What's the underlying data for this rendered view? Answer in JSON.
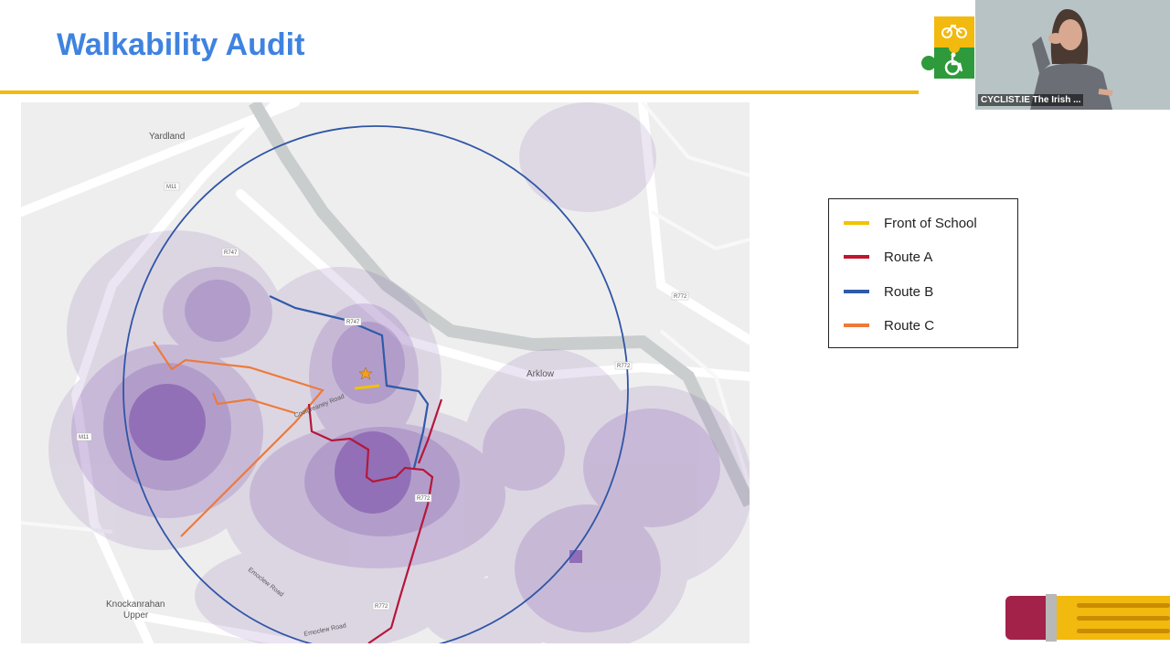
{
  "slide": {
    "title": "Walkability Audit"
  },
  "video": {
    "caption": "CYCLIST.IE The Irish ..."
  },
  "legend": {
    "items": [
      {
        "label": "Front of School",
        "color": "#f2c200"
      },
      {
        "label": "Route A",
        "color": "#c0152d"
      },
      {
        "label": "Route B",
        "color": "#2f5aa8"
      },
      {
        "label": "Route C",
        "color": "#ee7a3a"
      }
    ]
  },
  "map": {
    "places": {
      "yardland": "Yardland",
      "arklow": "Arklow",
      "knockanrahan": "Knockanrahan",
      "upper": "Upper"
    },
    "roads": {
      "m11_top": "M11",
      "m11_left": "M11",
      "r747_a": "R747",
      "r747_b": "R747",
      "r772_a": "R772",
      "r772_b": "R772",
      "r772_c": "R772",
      "r772_d": "R772",
      "coolgreaney": "Coolgreaney Road",
      "emoclew1": "Emoclew Road",
      "emoclew2": "Emoclew Road"
    },
    "colors": {
      "heat": "#6a3aa0",
      "circle": "#2f55a6"
    }
  }
}
